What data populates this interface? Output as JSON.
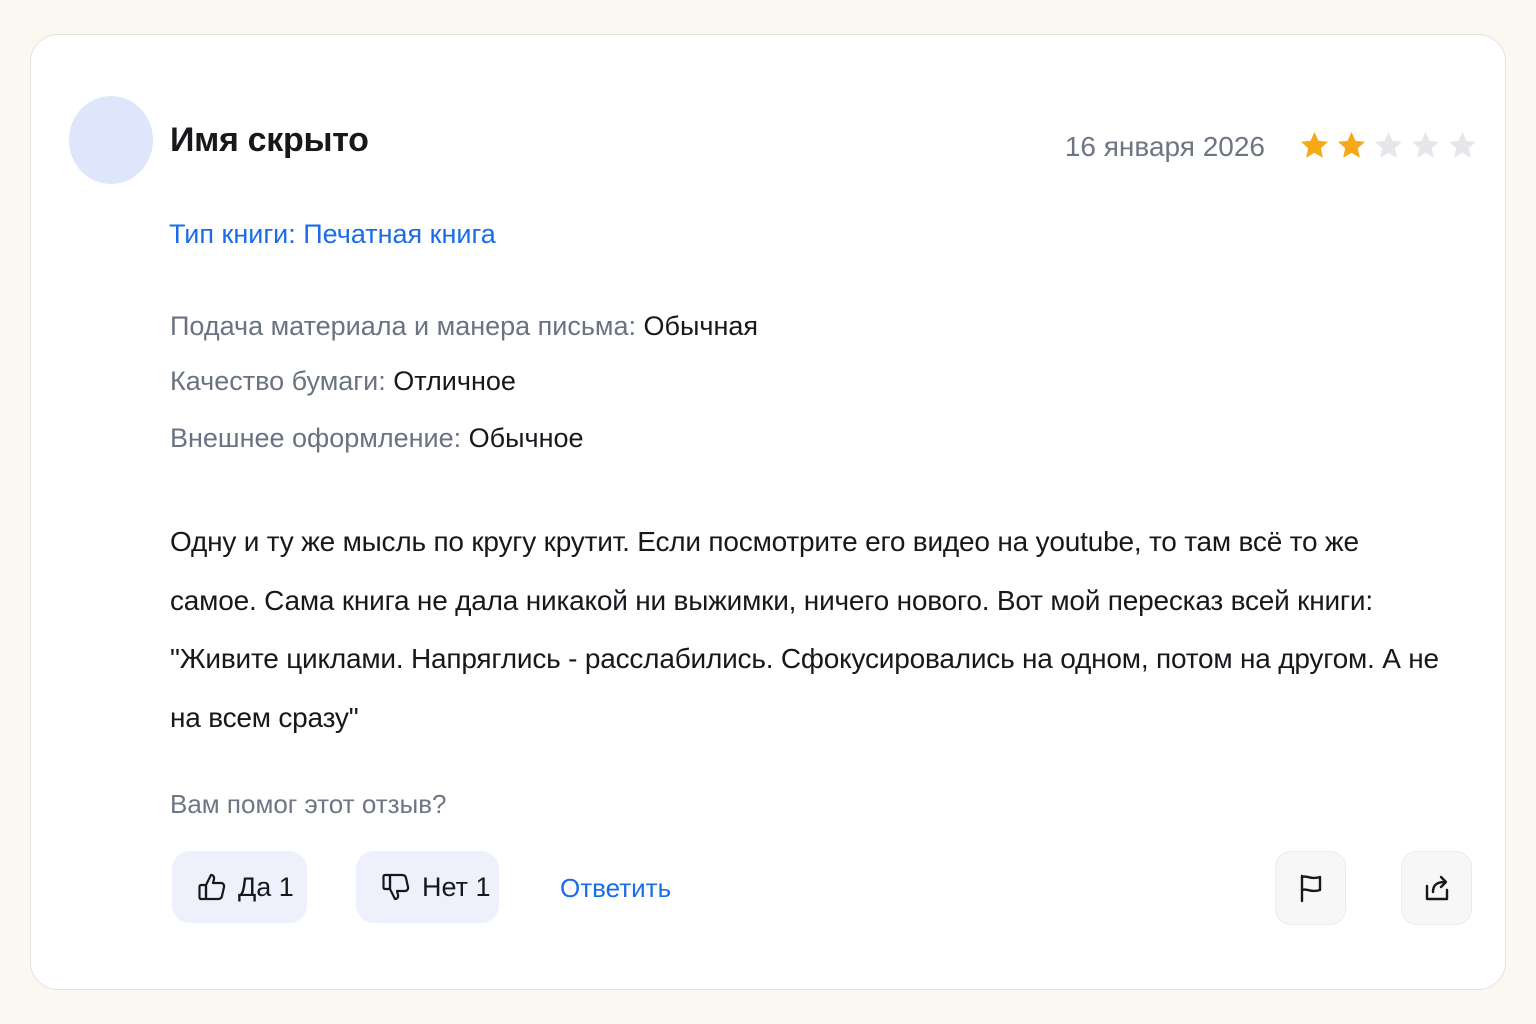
{
  "review": {
    "author": "Имя скрыто",
    "date": "16 января 2026",
    "rating": 2,
    "max_rating": 5,
    "book_type": "Тип книги: Печатная книга",
    "attributes": [
      {
        "label": "Подача материала и манера письма:",
        "value": "Обычная"
      },
      {
        "label": "Качество бумаги:",
        "value": "Отличное"
      },
      {
        "label": "Внешнее оформление:",
        "value": "Обычное"
      }
    ],
    "text": "Одну и ту же мысль по кругу крутит. Если посмотрите его видео на youtube, то там всё то же самое. Сама книга не дала никакой ни выжимки, ничего нового. Вот мой пересказ всей книги: \"Живите циклами. Напряглись - расслабились. Сфокусировались на одном, потом на другом. А не на всем сразу\""
  },
  "helpful": {
    "question": "Вам помог этот отзыв?",
    "yes_label": "Да 1",
    "no_label": "Нет 1",
    "reply_label": "Ответить"
  },
  "icons": {
    "thumb_up": "thumbs-up-icon",
    "thumb_down": "thumbs-down-icon",
    "report": "flag-icon",
    "share": "share-icon",
    "star": "star-icon"
  },
  "colors": {
    "star_filled": "#f6a816",
    "star_empty": "#e6e7eb",
    "link": "#1a6ce8",
    "avatar_bg": "#dde6fb",
    "vote_bg": "#eef1fb"
  }
}
